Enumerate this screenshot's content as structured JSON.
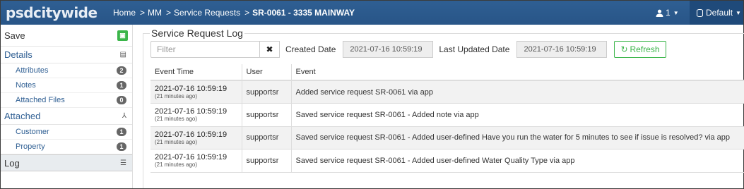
{
  "header": {
    "logo": "psdcitywide",
    "breadcrumbs": [
      "Home",
      ">",
      "MM",
      ">",
      "Service Requests",
      ">"
    ],
    "current": "SR-0061 - 3335 MAINWAY",
    "user_count": "1",
    "db_label": "Default",
    "icons": [
      "user-icon",
      "database-icon",
      "caret-down-icon"
    ]
  },
  "sidebar": {
    "save_label": "Save",
    "details_label": "Details",
    "details_items": [
      {
        "label": "Attributes",
        "count": "2"
      },
      {
        "label": "Notes",
        "count": "1"
      },
      {
        "label": "Attached Files",
        "count": "0"
      }
    ],
    "attached_label": "Attached",
    "attached_items": [
      {
        "label": "Customer",
        "count": "1"
      },
      {
        "label": "Property",
        "count": "1"
      }
    ],
    "log_label": "Log"
  },
  "log": {
    "title": "Service Request Log",
    "filter_placeholder": "Filter",
    "created_label": "Created Date",
    "created_value": "2021-07-16 10:59:19",
    "updated_label": "Last Updated Date",
    "updated_value": "2021-07-16 10:59:19",
    "refresh_label": "Refresh",
    "columns": [
      "Event Time",
      "User",
      "Event"
    ],
    "rows": [
      {
        "time": "2021-07-16 10:59:19",
        "ago": "(21 minutes ago)",
        "user": "supportsr",
        "event": "Added service request SR-0061 via app"
      },
      {
        "time": "2021-07-16 10:59:19",
        "ago": "(21 minutes ago)",
        "user": "supportsr",
        "event": "Saved service request SR-0061 - Added note via app"
      },
      {
        "time": "2021-07-16 10:59:19",
        "ago": "(21 minutes ago)",
        "user": "supportsr",
        "event": "Saved service request SR-0061 - Added user-defined Have you run the water for 5 minutes to see if issue is resolved? via app"
      },
      {
        "time": "2021-07-16 10:59:19",
        "ago": "(21 minutes ago)",
        "user": "supportsr",
        "event": "Saved service request SR-0061 - Added user-defined Water Quality Type via app"
      }
    ]
  },
  "colors": {
    "topbar": "#2f5f93",
    "accent_green": "#3bb54a",
    "link": "#2f5f93"
  }
}
